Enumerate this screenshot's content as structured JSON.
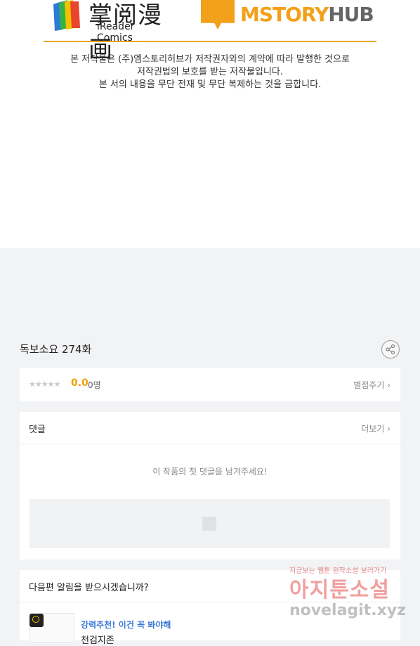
{
  "logos": {
    "ireader_cn": "掌阅漫画",
    "ireader_en": "iReader Comics",
    "mstory_main": "MSTORY",
    "mstory_hub": "HUB"
  },
  "notice": {
    "line1": "본 저작물은 (주)엠스토리허브가 저작권자와의 계약에 따라 발행한 것으로",
    "line2": "저작권법의 보호를 받는 저작물입니다.",
    "line3": "본 서의 내용을 무단 전재 및 무단 복제하는 것을 금합니다."
  },
  "episode": {
    "title": "독보소요 274화"
  },
  "rating": {
    "stars": "★★★★★",
    "score": "0.0",
    "count": "0명",
    "rate_label": "별점주기 ›"
  },
  "comments": {
    "title": "댓글",
    "more_label": "더보기 ›",
    "empty_text": "이 작품의 첫 댓글을 남겨주세요!"
  },
  "next": {
    "question": "다음편 알림을 받으시겠습니까?",
    "promo": "강력추천! 이건 꼭 봐야해",
    "rec_title": "천검지존"
  },
  "watermark": {
    "small": "지금보는 웹툰 원작소설 보러가기",
    "big": "아지툰소설",
    "url": "novelagit.xyz"
  },
  "colors": {
    "accent": "#f2a100",
    "link": "#3a78d6",
    "divider": "#e4a300"
  }
}
